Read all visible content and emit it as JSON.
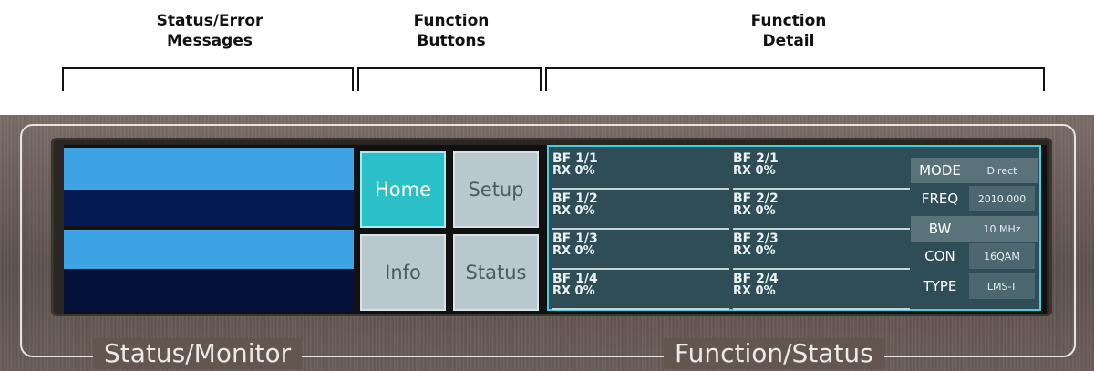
{
  "callouts": {
    "status_error": [
      "Status/Error",
      "Messages"
    ],
    "function_buttons": [
      "Function",
      "Buttons"
    ],
    "function_detail": [
      "Function",
      "Detail"
    ]
  },
  "panel": {
    "left_label": "Status/Monitor",
    "right_label": "Function/Status"
  },
  "status_bars": [
    {
      "color": "#3ea3e5"
    },
    {
      "color": "#061a52"
    },
    {
      "color": "#3ea3e5"
    },
    {
      "color": "#061a52"
    }
  ],
  "buttons": {
    "home": "Home",
    "setup": "Setup",
    "info": "Info",
    "status": "Status"
  },
  "channels": [
    {
      "name": "BF 1/1",
      "rx": "RX 0%"
    },
    {
      "name": "BF 1/2",
      "rx": "RX 0%"
    },
    {
      "name": "BF 1/3",
      "rx": "RX 0%"
    },
    {
      "name": "BF 1/4",
      "rx": "RX 0%"
    },
    {
      "name": "BF 2/1",
      "rx": "RX 0%"
    },
    {
      "name": "BF 2/2",
      "rx": "RX 0%"
    },
    {
      "name": "BF 2/3",
      "rx": "RX 0%"
    },
    {
      "name": "BF 2/4",
      "rx": "RX 0%"
    }
  ],
  "params": [
    {
      "key": "MODE",
      "value": "Direct"
    },
    {
      "key": "FREQ",
      "value": "2010.000"
    },
    {
      "key": "BW",
      "value": "10 MHz"
    },
    {
      "key": "CON",
      "value": "16QAM"
    },
    {
      "key": "TYPE",
      "value": "LMS-T"
    }
  ],
  "colors": {
    "accent_cyan": "#2bbfc7",
    "detail_bg": "#2f4d57"
  }
}
